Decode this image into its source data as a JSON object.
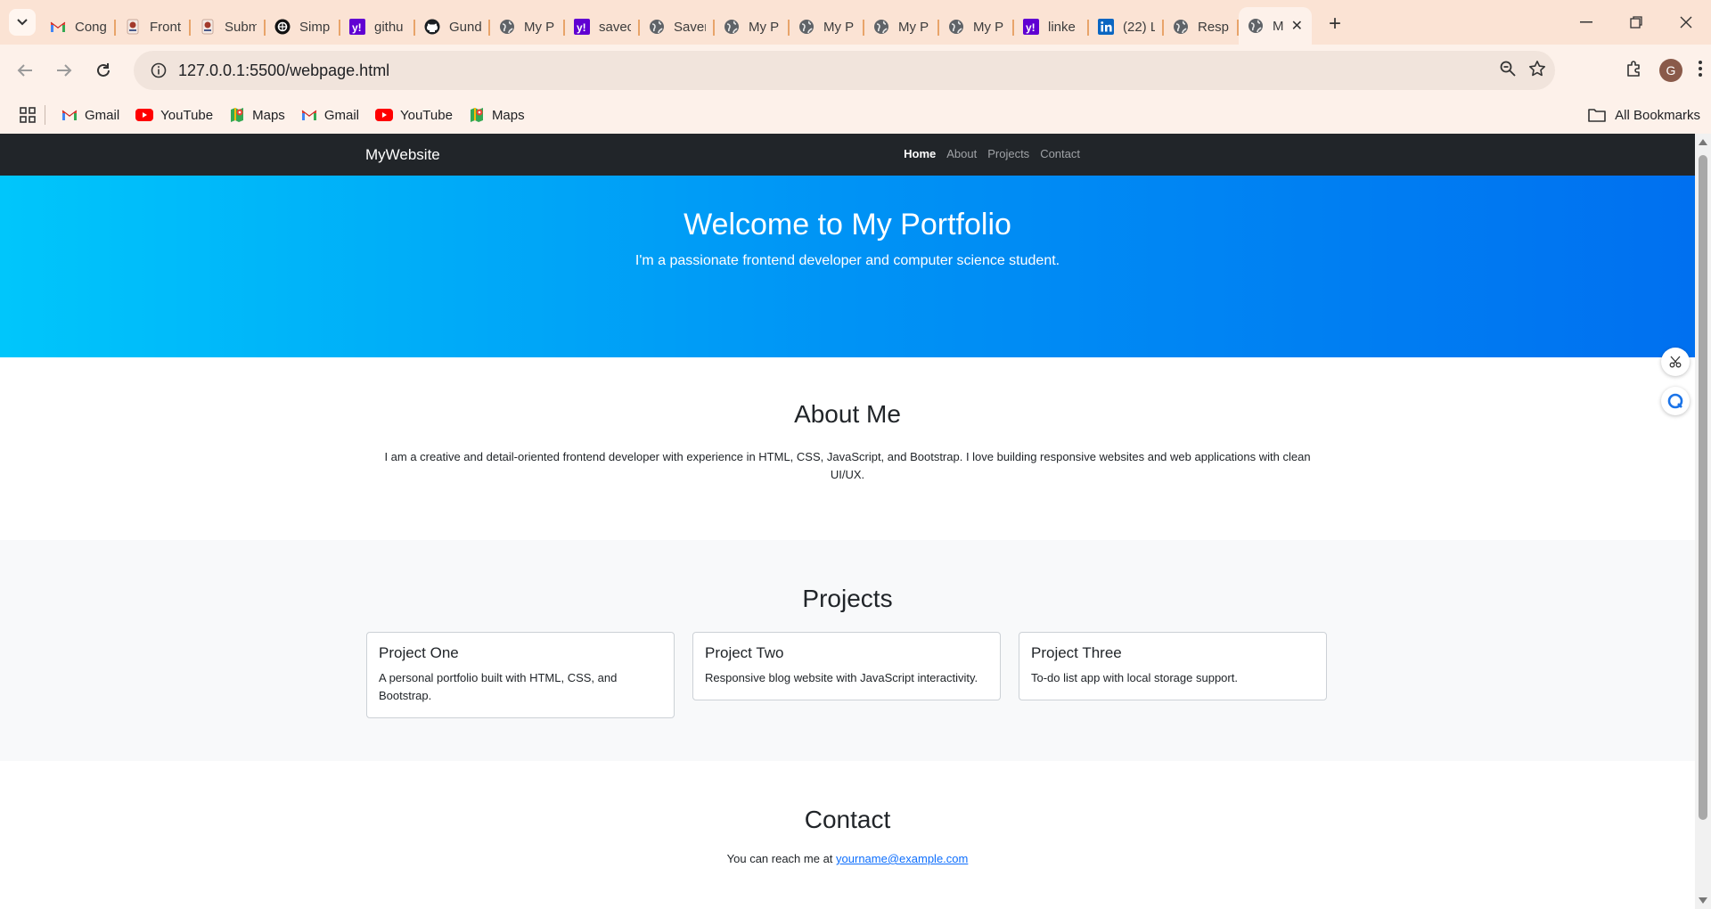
{
  "browser": {
    "tabs": [
      {
        "icon": "gmail-icon",
        "label": "Cong"
      },
      {
        "icon": "university-icon",
        "label": "Front"
      },
      {
        "icon": "university-icon",
        "label": "Subm"
      },
      {
        "icon": "chatgpt-icon",
        "label": "Simp"
      },
      {
        "icon": "yahoo-icon",
        "label": "githu"
      },
      {
        "icon": "github-icon",
        "label": "Gund"
      },
      {
        "icon": "globe-icon",
        "label": "My P"
      },
      {
        "icon": "yahoo-icon",
        "label": "savec"
      },
      {
        "icon": "globe-icon",
        "label": "Saver"
      },
      {
        "icon": "globe-icon",
        "label": "My P"
      },
      {
        "icon": "globe-icon",
        "label": "My P"
      },
      {
        "icon": "globe-icon",
        "label": "My P"
      },
      {
        "icon": "globe-icon",
        "label": "My P"
      },
      {
        "icon": "yahoo-icon",
        "label": "linke"
      },
      {
        "icon": "linkedin-icon",
        "label": "(22) L"
      },
      {
        "icon": "globe-icon",
        "label": "Resp"
      }
    ],
    "active_tab": {
      "icon": "globe-icon",
      "label": "M"
    },
    "url": "127.0.0.1:5500/webpage.html",
    "profile_initial": "G",
    "bookmarks": [
      {
        "icon": "gmail-icon",
        "label": "Gmail"
      },
      {
        "icon": "youtube-icon",
        "label": "YouTube"
      },
      {
        "icon": "maps-icon",
        "label": "Maps"
      },
      {
        "icon": "gmail-icon",
        "label": "Gmail"
      },
      {
        "icon": "youtube-icon",
        "label": "YouTube"
      },
      {
        "icon": "maps-icon",
        "label": "Maps"
      }
    ],
    "all_bookmarks": "All Bookmarks"
  },
  "site": {
    "brand": "MyWebsite",
    "nav": [
      "Home",
      "About",
      "Projects",
      "Contact"
    ],
    "hero": {
      "title": "Welcome to My Portfolio",
      "subtitle": "I'm a passionate frontend developer and computer science student."
    },
    "about": {
      "title": "About Me",
      "text": "I am a creative and detail-oriented frontend developer with experience in HTML, CSS, JavaScript, and Bootstrap. I love building responsive websites and web applications with clean UI/UX."
    },
    "projects": {
      "title": "Projects",
      "items": [
        {
          "title": "Project One",
          "text": "A personal portfolio built with HTML, CSS, and Bootstrap."
        },
        {
          "title": "Project Two",
          "text": "Responsive blog website with JavaScript interactivity."
        },
        {
          "title": "Project Three",
          "text": "To-do list app with local storage support."
        }
      ]
    },
    "contact": {
      "title": "Contact",
      "text": "You can reach me at",
      "email": "yourname@example.com"
    }
  },
  "colors": {
    "navbar": "#212529",
    "hero_start": "#00c6fb",
    "hero_end": "#0070f0",
    "link": "#0d6efd"
  }
}
